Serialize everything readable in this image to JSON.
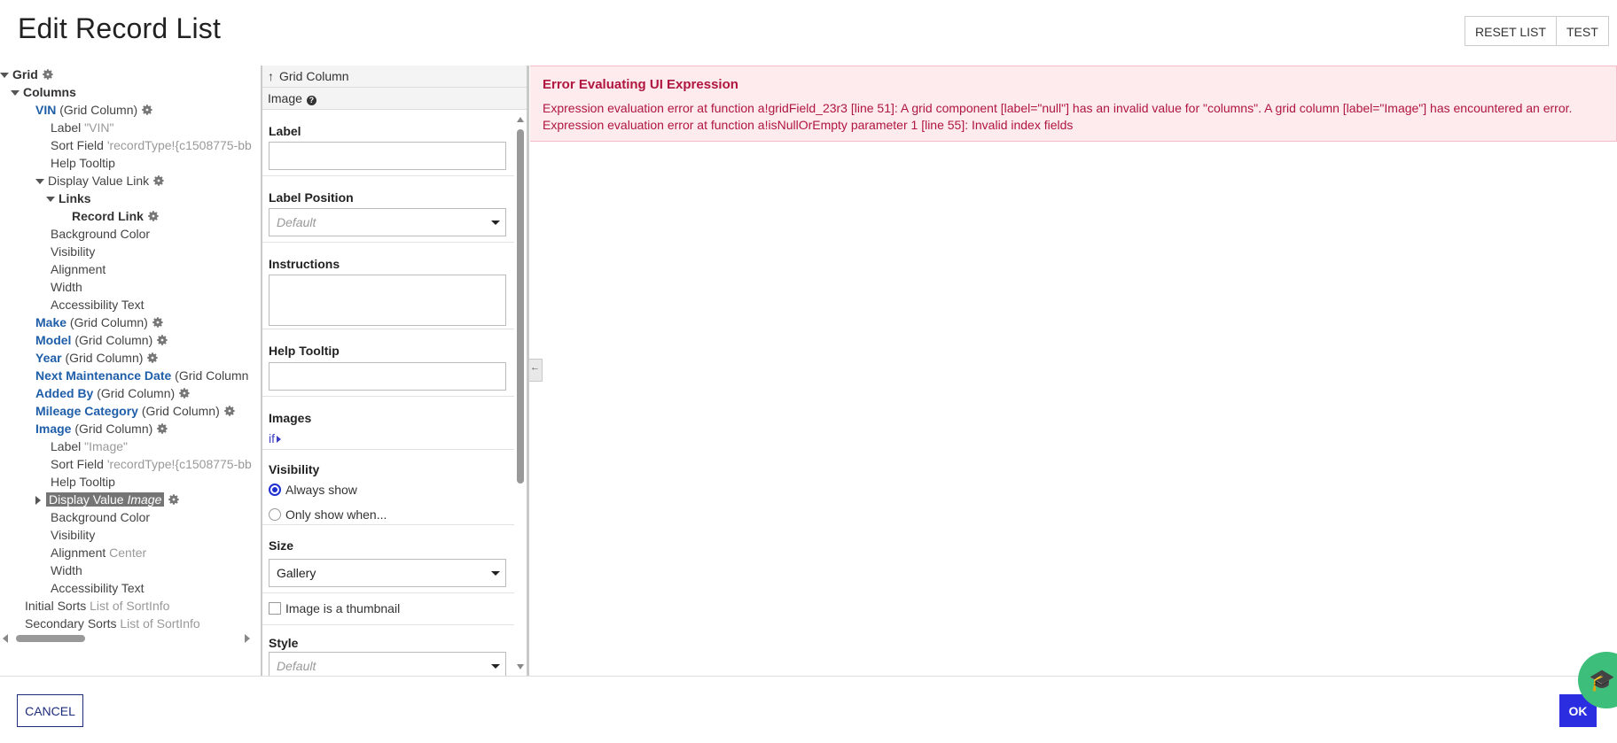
{
  "header": {
    "title": "Edit Record List",
    "reset_label": "RESET LIST",
    "test_label": "TEST"
  },
  "tree": {
    "grid": "Grid",
    "columns": "Columns",
    "vin": {
      "name": "VIN",
      "type": "(Grid Column)"
    },
    "vin_label_key": "Label",
    "vin_label_val": "\"VIN\"",
    "vin_sort_key": "Sort Field",
    "vin_sort_val": "'recordType!{c1508775-bb",
    "vin_help": "Help Tooltip",
    "display_value_link": "Display Value Link",
    "links": "Links",
    "record_link": "Record Link",
    "vin_bg": "Background Color",
    "vin_visibility": "Visibility",
    "vin_alignment": "Alignment",
    "vin_width": "Width",
    "vin_access": "Accessibility Text",
    "make": {
      "name": "Make",
      "type": "(Grid Column)"
    },
    "model": {
      "name": "Model",
      "type": "(Grid Column)"
    },
    "year": {
      "name": "Year",
      "type": "(Grid Column)"
    },
    "next_maint": {
      "name": "Next Maintenance Date",
      "type": "(Grid Column"
    },
    "added_by": {
      "name": "Added By",
      "type": "(Grid Column)"
    },
    "mileage": {
      "name": "Mileage Category",
      "type": "(Grid Column)"
    },
    "image": {
      "name": "Image",
      "type": "(Grid Column)"
    },
    "img_label_key": "Label",
    "img_label_val": "\"Image\"",
    "img_sort_key": "Sort Field",
    "img_sort_val": "'recordType!{c1508775-bb",
    "img_help": "Help Tooltip",
    "display_value": "Display Value",
    "display_value_italic": "Image",
    "img_bg": "Background Color",
    "img_visibility": "Visibility",
    "img_alignment_key": "Alignment",
    "img_alignment_val": "Center",
    "img_width": "Width",
    "img_access": "Accessibility Text",
    "initial_sorts_key": "Initial Sorts",
    "initial_sorts_val": "List of SortInfo",
    "secondary_sorts_key": "Secondary Sorts",
    "secondary_sorts_val": "List of SortInfo"
  },
  "config": {
    "breadcrumb": "Grid Column",
    "component": "Image",
    "label": {
      "title": "Label",
      "value": ""
    },
    "label_position": {
      "title": "Label Position",
      "value": "Default"
    },
    "instructions": {
      "title": "Instructions"
    },
    "help_tooltip": {
      "title": "Help Tooltip",
      "value": ""
    },
    "images": {
      "title": "Images",
      "value": "if"
    },
    "visibility": {
      "title": "Visibility",
      "opt1": "Always show",
      "opt2": "Only show when..."
    },
    "size": {
      "title": "Size",
      "value": "Gallery"
    },
    "thumbnail": "Image is a thumbnail",
    "style": {
      "title": "Style",
      "value": "Default"
    }
  },
  "error": {
    "title": "Error Evaluating UI Expression",
    "message": "Expression evaluation error at function a!gridField_23r3 [line 51]: A grid component [label=\"null\"] has an invalid value for \"columns\". A grid column [label=\"Image\"] has encountered an error. Expression evaluation error at function a!isNullOrEmpty parameter 1 [line 55]: Invalid index fields"
  },
  "footer": {
    "cancel_label": "CANCEL",
    "ok_label": "OK"
  },
  "colors": {
    "link": "#1f5ea8",
    "error_text": "#b0163f",
    "error_bg": "#fdebee",
    "primary": "#2a2de0",
    "fab": "#3dbf7b"
  },
  "icons": [
    "gear-icon",
    "help-icon",
    "arrow-up-icon",
    "chevron-down-icon",
    "caret-right-icon",
    "collapse-left-icon",
    "graduation-cap-icon"
  ]
}
